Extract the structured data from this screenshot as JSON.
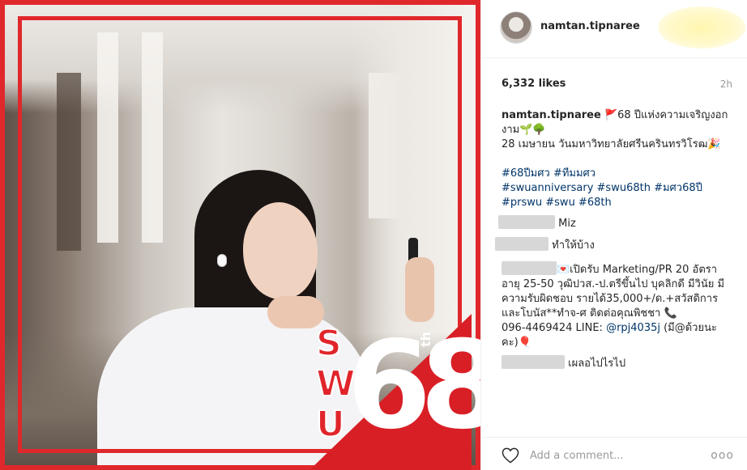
{
  "post": {
    "username": "namtan.tipnaree",
    "likes": "6,332 likes",
    "time": "2h",
    "badge": {
      "letters": [
        "S",
        "W",
        "U"
      ],
      "number": "68",
      "suffix": "th"
    }
  },
  "caption": {
    "user": "namtan.tipnaree",
    "line1": " 🚩68 ปีแห่งความเจริญงอก",
    "line2": "งาม🌱🌳",
    "line3": "28 เมษายน วันมหาวิทยาลัยศรีนครินทรวิโรฒ🎉",
    "tags1": "#68ปีมศว #ทีมมศว",
    "tags2": "#swuanniversary #swu68th #มศว68ปี",
    "tags3": "#prswu #swu #68th"
  },
  "comments": [
    {
      "text": " Miz"
    },
    {
      "text": " ทำให้บ้าง"
    },
    {
      "line1": "💌เปิดรับ Marketing/PR 20 อัตรา",
      "line2": "อายุ 25-50 วุฒิปวส.-ป.ตรีขึ้นไป บุคลิกดี มีวินัย มี",
      "line3": "ความรับผิดชอบ รายได้35,000+/ด.+สวัสดิการ",
      "line4": "และโบนัส**ทำจ-ศ ติดต่อคุณพิชชา 📞",
      "line5a": "096-4469424 LINE: ",
      "mention": "@rpj4035j",
      "line5b": " (มี@ด้วยนะ",
      "line6": "คะ)🎈"
    },
    {
      "text": " เผลอไปไรไป"
    }
  ],
  "footer": {
    "placeholder": "Add a comment...",
    "more": "ooo"
  },
  "icons": {
    "like": "heart-outline-icon",
    "options": "more-options-icon"
  },
  "colors": {
    "frame_red": "#e0282c",
    "hashtag": "#003569"
  }
}
